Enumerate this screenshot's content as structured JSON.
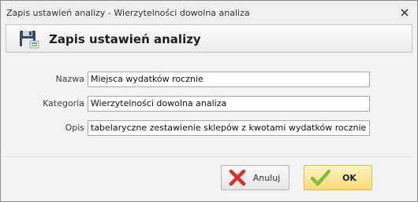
{
  "window": {
    "title": "Zapis ustawień analizy - Wierzytelności dowolna analiza"
  },
  "header": {
    "title": "Zapis ustawień analizy",
    "icon": "save-disk-icon"
  },
  "form": {
    "name_label": "Nazwa",
    "name_value": "Miejsca wydatków rocznie",
    "category_label": "Kategoria",
    "category_value": "Wierzytelności dowolna analiza",
    "description_label": "Opis",
    "description_value": "tabelaryczne zestawienie sklepów z kwotami wydatków rocznie"
  },
  "buttons": {
    "cancel_label": "Anuluj",
    "ok_label": "OK"
  },
  "colors": {
    "ok_button_bg": "#fbd97a",
    "cancel_icon": "#d9302c",
    "ok_icon": "#7cc242"
  }
}
